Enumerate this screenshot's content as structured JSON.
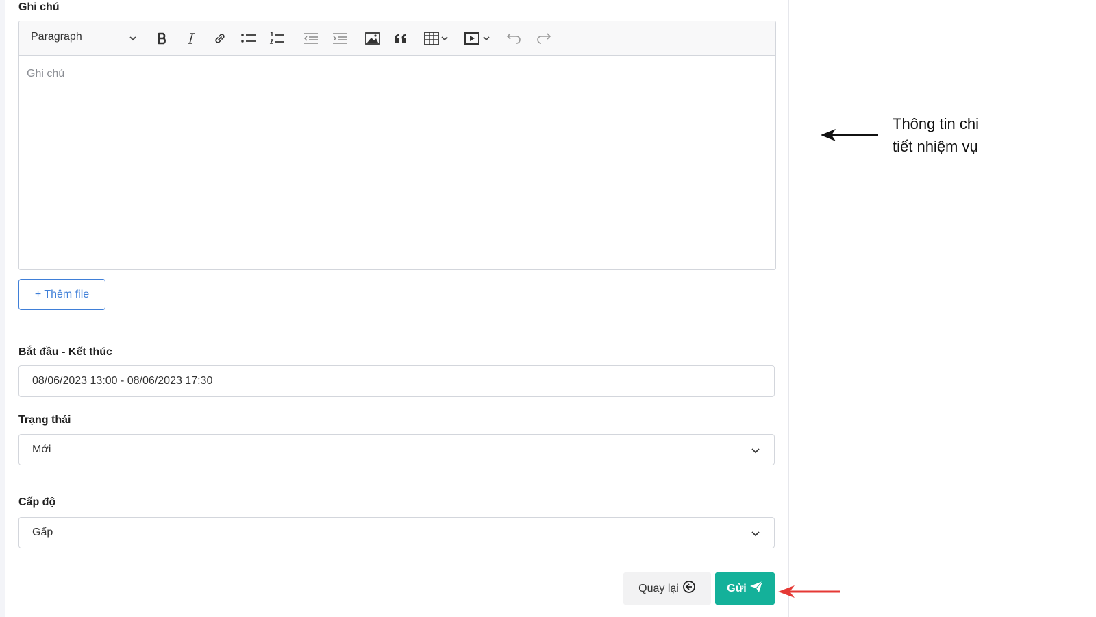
{
  "notes": {
    "label": "Ghi chú",
    "placeholder": "Ghi chú",
    "toolbar": {
      "paragraph": "Paragraph",
      "buttons": [
        "bold-icon",
        "italic-icon",
        "link-icon",
        "bulleted-list-icon",
        "numbered-list-icon",
        "outdent-icon",
        "indent-icon",
        "image-icon",
        "blockquote-icon",
        "table-icon",
        "media-icon",
        "undo-icon",
        "redo-icon"
      ]
    }
  },
  "add_file": {
    "label": "+ Thêm file"
  },
  "schedule": {
    "label": "Bắt đầu - Kết thúc",
    "value": "08/06/2023 13:00 - 08/06/2023 17:30"
  },
  "status": {
    "label": "Trạng thái",
    "value": "Mới"
  },
  "level": {
    "label": "Cấp độ",
    "value": "Gấp"
  },
  "actions": {
    "back": "Quay lại",
    "send": "Gửi"
  },
  "annotation": {
    "line1": "Thông tin chi",
    "line2": "tiết nhiệm vụ"
  },
  "colors": {
    "accent": "#14b19a",
    "link": "#3f7fd8",
    "annotation_red": "#e53935"
  }
}
